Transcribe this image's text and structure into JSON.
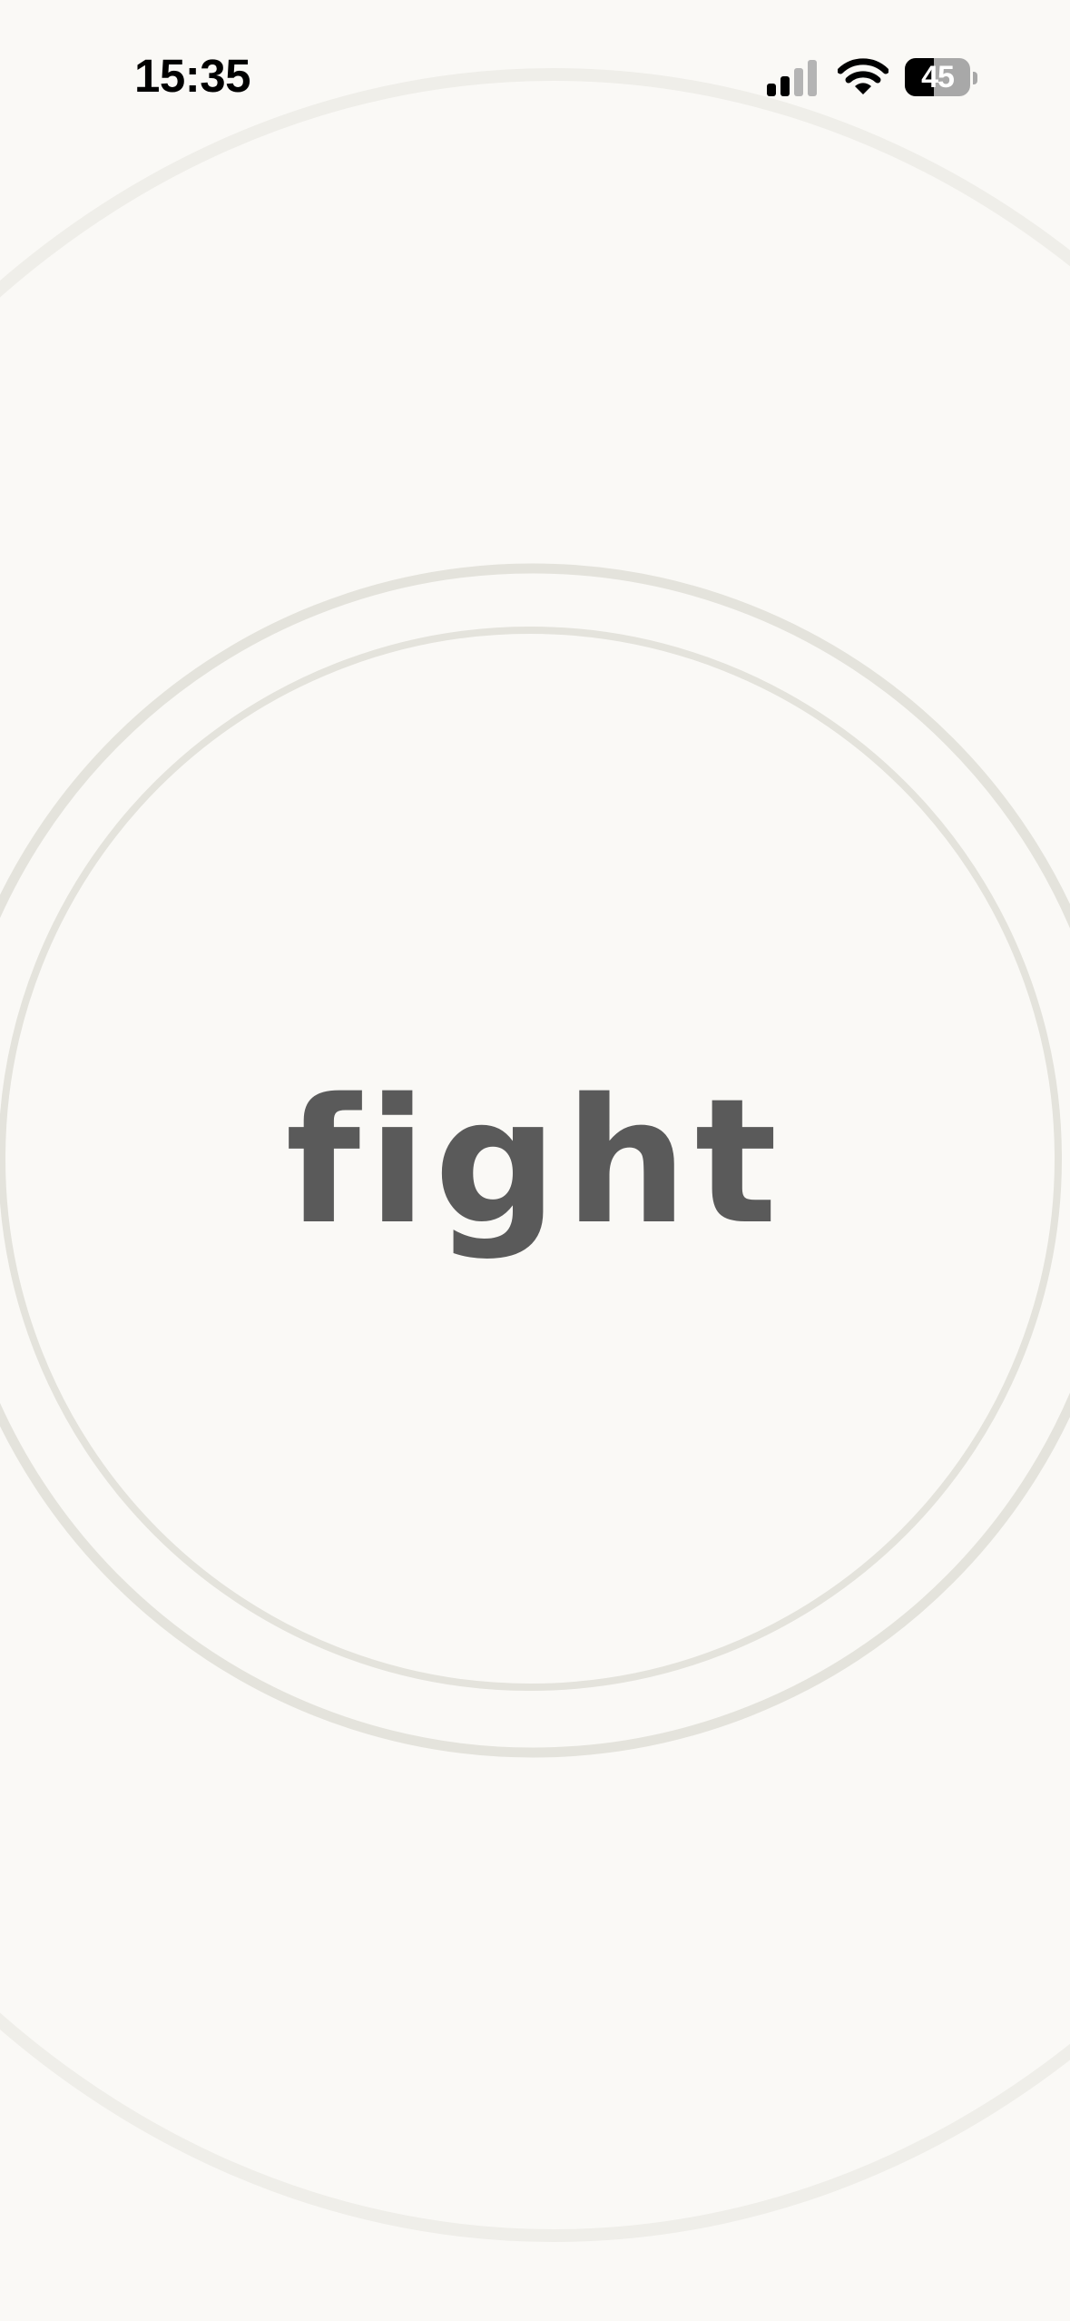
{
  "status_bar": {
    "time": "15:35",
    "signal_icon": "cellular-signal-icon",
    "signal_bars_active": 2,
    "signal_bars_total": 4,
    "wifi_icon": "wifi-icon",
    "battery_icon": "battery-icon",
    "battery_level": "45",
    "battery_fraction": 0.45
  },
  "main": {
    "word": "fight"
  },
  "colors": {
    "background": "#faf9f6",
    "ring": "#e4e3dc",
    "text": "#5a5a5a"
  }
}
